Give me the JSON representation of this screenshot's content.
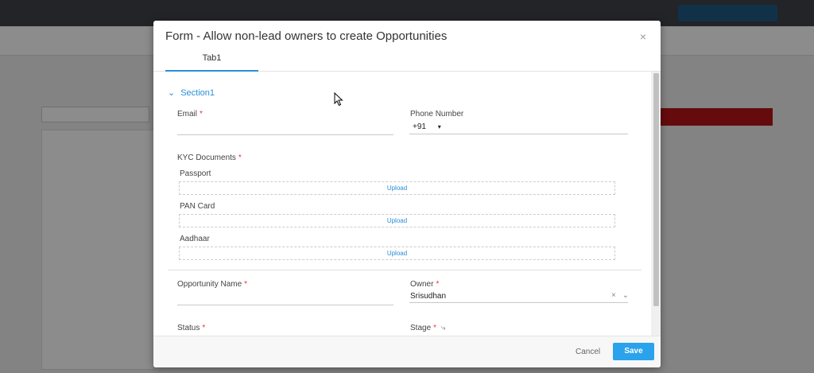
{
  "modal": {
    "title": "Form - Allow non-lead owners to create Opportunities",
    "close_glyph": "×"
  },
  "tabs": [
    {
      "label": "Tab1"
    }
  ],
  "section": {
    "chevron": "⌄",
    "label": "Section1"
  },
  "fields": {
    "email": {
      "label": "Email",
      "required_mark": "*",
      "value": ""
    },
    "phone": {
      "label": "Phone Number",
      "country_code": "+91",
      "dropdown_glyph": "▾",
      "value": ""
    },
    "kyc": {
      "label": "KYC Documents",
      "required_mark": "*",
      "documents": [
        {
          "label": "Passport",
          "action": "Upload"
        },
        {
          "label": "PAN Card",
          "action": "Upload"
        },
        {
          "label": "Aadhaar",
          "action": "Upload"
        }
      ]
    },
    "opportunity_name": {
      "label": "Opportunity Name",
      "required_mark": "*",
      "value": ""
    },
    "owner": {
      "label": "Owner",
      "required_mark": "*",
      "value": "Srisudhan",
      "clear_glyph": "×",
      "dropdown_glyph": "⌄"
    },
    "status": {
      "label": "Status",
      "required_mark": "*"
    },
    "stage": {
      "label": "Stage",
      "required_mark": "*",
      "link_glyph": "⤷"
    }
  },
  "footer": {
    "cancel_label": "Cancel",
    "save_label": "Save"
  },
  "colors": {
    "accent": "#2a8fd6",
    "save_button": "#2ba2ec",
    "required": "#e33333"
  }
}
